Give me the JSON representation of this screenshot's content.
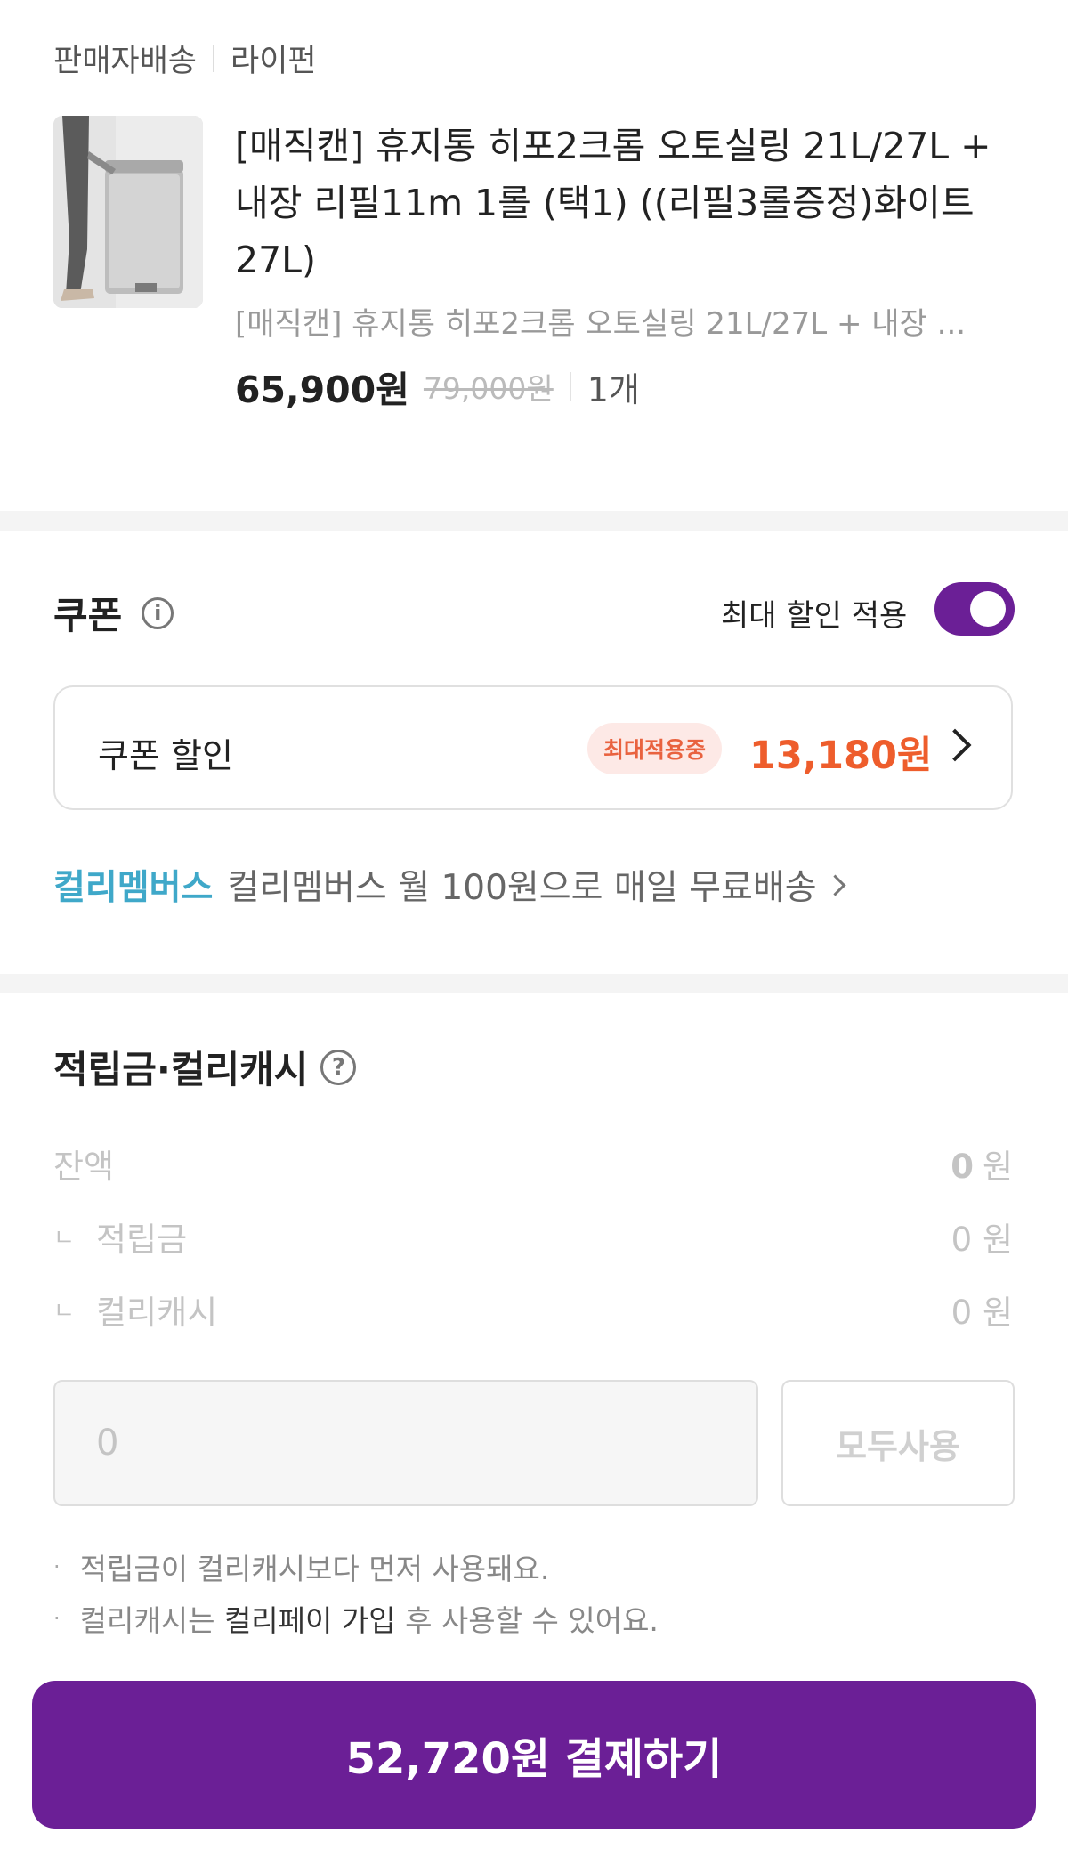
{
  "seller": {
    "delivery": "판매자배송",
    "name": "라이펀"
  },
  "product": {
    "title": "[매직캔] 휴지통 히포2크롬 오토실링 21L/27L + 내장 리필11m 1롤 (택1) ((리필3롤증정)화이트27L)",
    "subtitle": "[매직캔] 휴지통 히포2크롬 오토실링 21L/27L + 내장 ...",
    "price": "65,900원",
    "original_price": "79,000원",
    "quantity": "1개"
  },
  "coupon": {
    "title": "쿠폰",
    "max_discount_label": "최대 할인 적용",
    "max_discount_enabled": true,
    "row_label": "쿠폰 할인",
    "badge": "최대적용중",
    "amount": "13,180원"
  },
  "membership": {
    "brand": "컬리멤버스",
    "desc": "컬리멤버스 월 100원으로 매일 무료배송"
  },
  "points": {
    "title": "적립금·컬리캐시",
    "balance_label": "잔액",
    "balance_value": "0",
    "unit": "원",
    "reserve_label": "적립금",
    "reserve_value": "0 원",
    "cash_label": "컬리캐시",
    "cash_value": "0 원",
    "tree_mark": "ㄴ",
    "input_placeholder": "0",
    "use_all_label": "모두사용",
    "note1": "적립금이 컬리캐시보다 먼저 사용돼요.",
    "note2_pre": "컬리캐시는 ",
    "note2_strong": "컬리페이 가입",
    "note2_post": " 후 사용할 수 있어요.",
    "bullet": "·"
  },
  "payment": {
    "button_label": "52,720원 결제하기"
  },
  "colors": {
    "brand_purple": "#6b1f96",
    "coupon_orange": "#ee5d2c",
    "membership_teal": "#3fa8c9"
  }
}
